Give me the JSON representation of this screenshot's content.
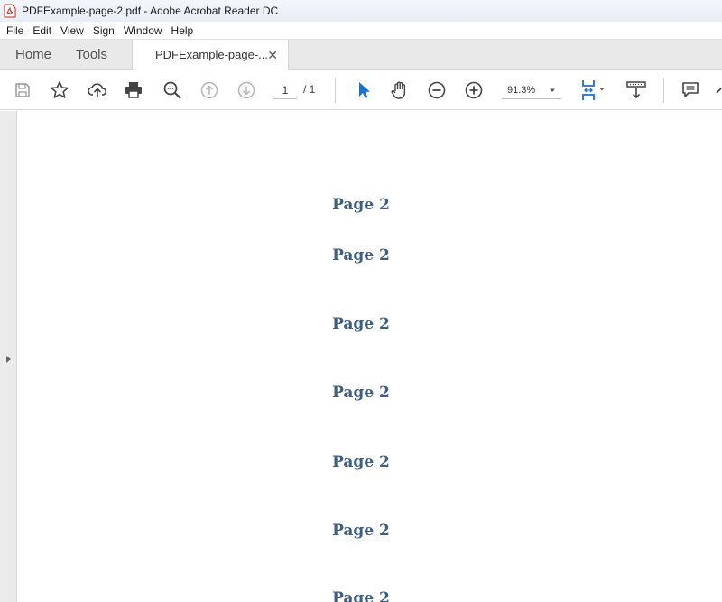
{
  "window": {
    "title": "PDFExample-page-2.pdf - Adobe Acrobat Reader DC"
  },
  "menu": {
    "items": [
      "File",
      "Edit",
      "View",
      "Sign",
      "Window",
      "Help"
    ]
  },
  "tabs": {
    "home": "Home",
    "tools": "Tools",
    "document": "PDFExample-page-...",
    "close_symbol": "✕"
  },
  "toolbar": {
    "page_current": "1",
    "page_total": "/  1",
    "zoom": "91.3%"
  },
  "document": {
    "headings": [
      "Page 2",
      "Page 2",
      "Page 2",
      "Page 2",
      "Page 2",
      "Page 2",
      "Page 2"
    ]
  },
  "colors": {
    "heading": "#3d5f87",
    "accent_blue": "#1f6fd1"
  }
}
